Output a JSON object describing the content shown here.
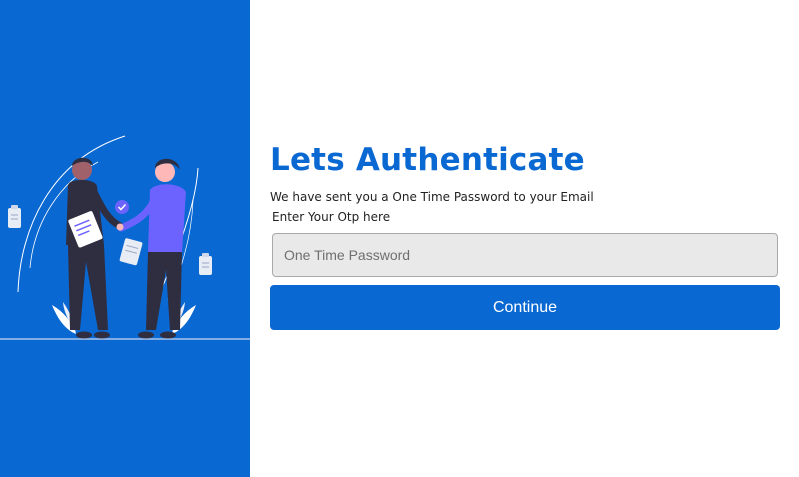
{
  "auth": {
    "title": "Lets Authenticate",
    "subtitle": "We have sent you a One Time Password to your Email",
    "otp_label": "Enter Your Otp here",
    "otp_placeholder": "One Time Password",
    "otp_value": "",
    "continue_label": "Continue"
  },
  "illustration": {
    "icon": "handshake-illustration-icon",
    "colors": {
      "panel": "#0a68d2",
      "accent_purple": "#6c63ff",
      "dark_figure": "#2f2e41",
      "skin_dark": "#a0616a",
      "white": "#ffffff"
    }
  }
}
